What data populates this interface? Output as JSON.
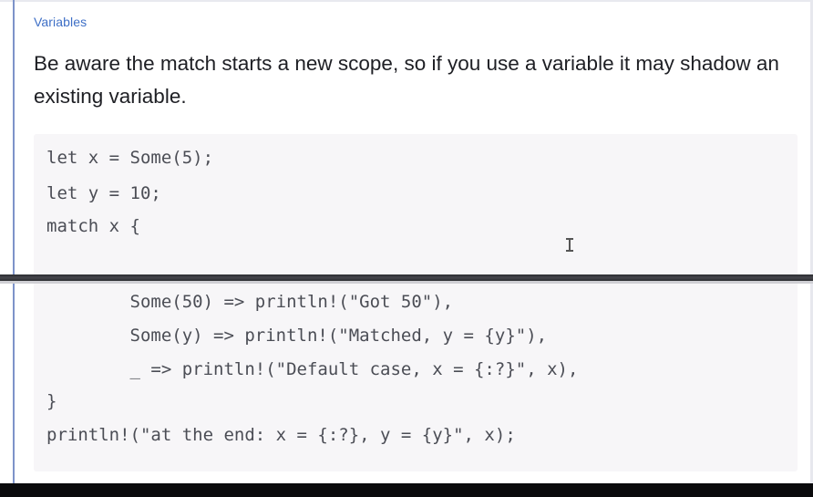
{
  "section_label": "Variables",
  "paragraph": "Be aware the match starts a new scope, so if you use a variable it may shadow an existing variable.",
  "code_lines": [
    "let x = Some(5);",
    "let y = 10;",
    "match x {",
    "        Some(50) => println!(\"Got 50\"),",
    "        Some(y) => println!(\"Matched, y = {y}\"),",
    "        _ => println!(\"Default case, x = {:?}\", x),",
    "}",
    "println!(\"at the end: x = {:?}, y = {y}\", x);"
  ],
  "icons": {
    "text_cursor": "i-beam-cursor-icon"
  },
  "colors": {
    "accent": "#3e6fc6",
    "left_rule": "#7d93c9",
    "code_background": "#f7f6f8"
  }
}
